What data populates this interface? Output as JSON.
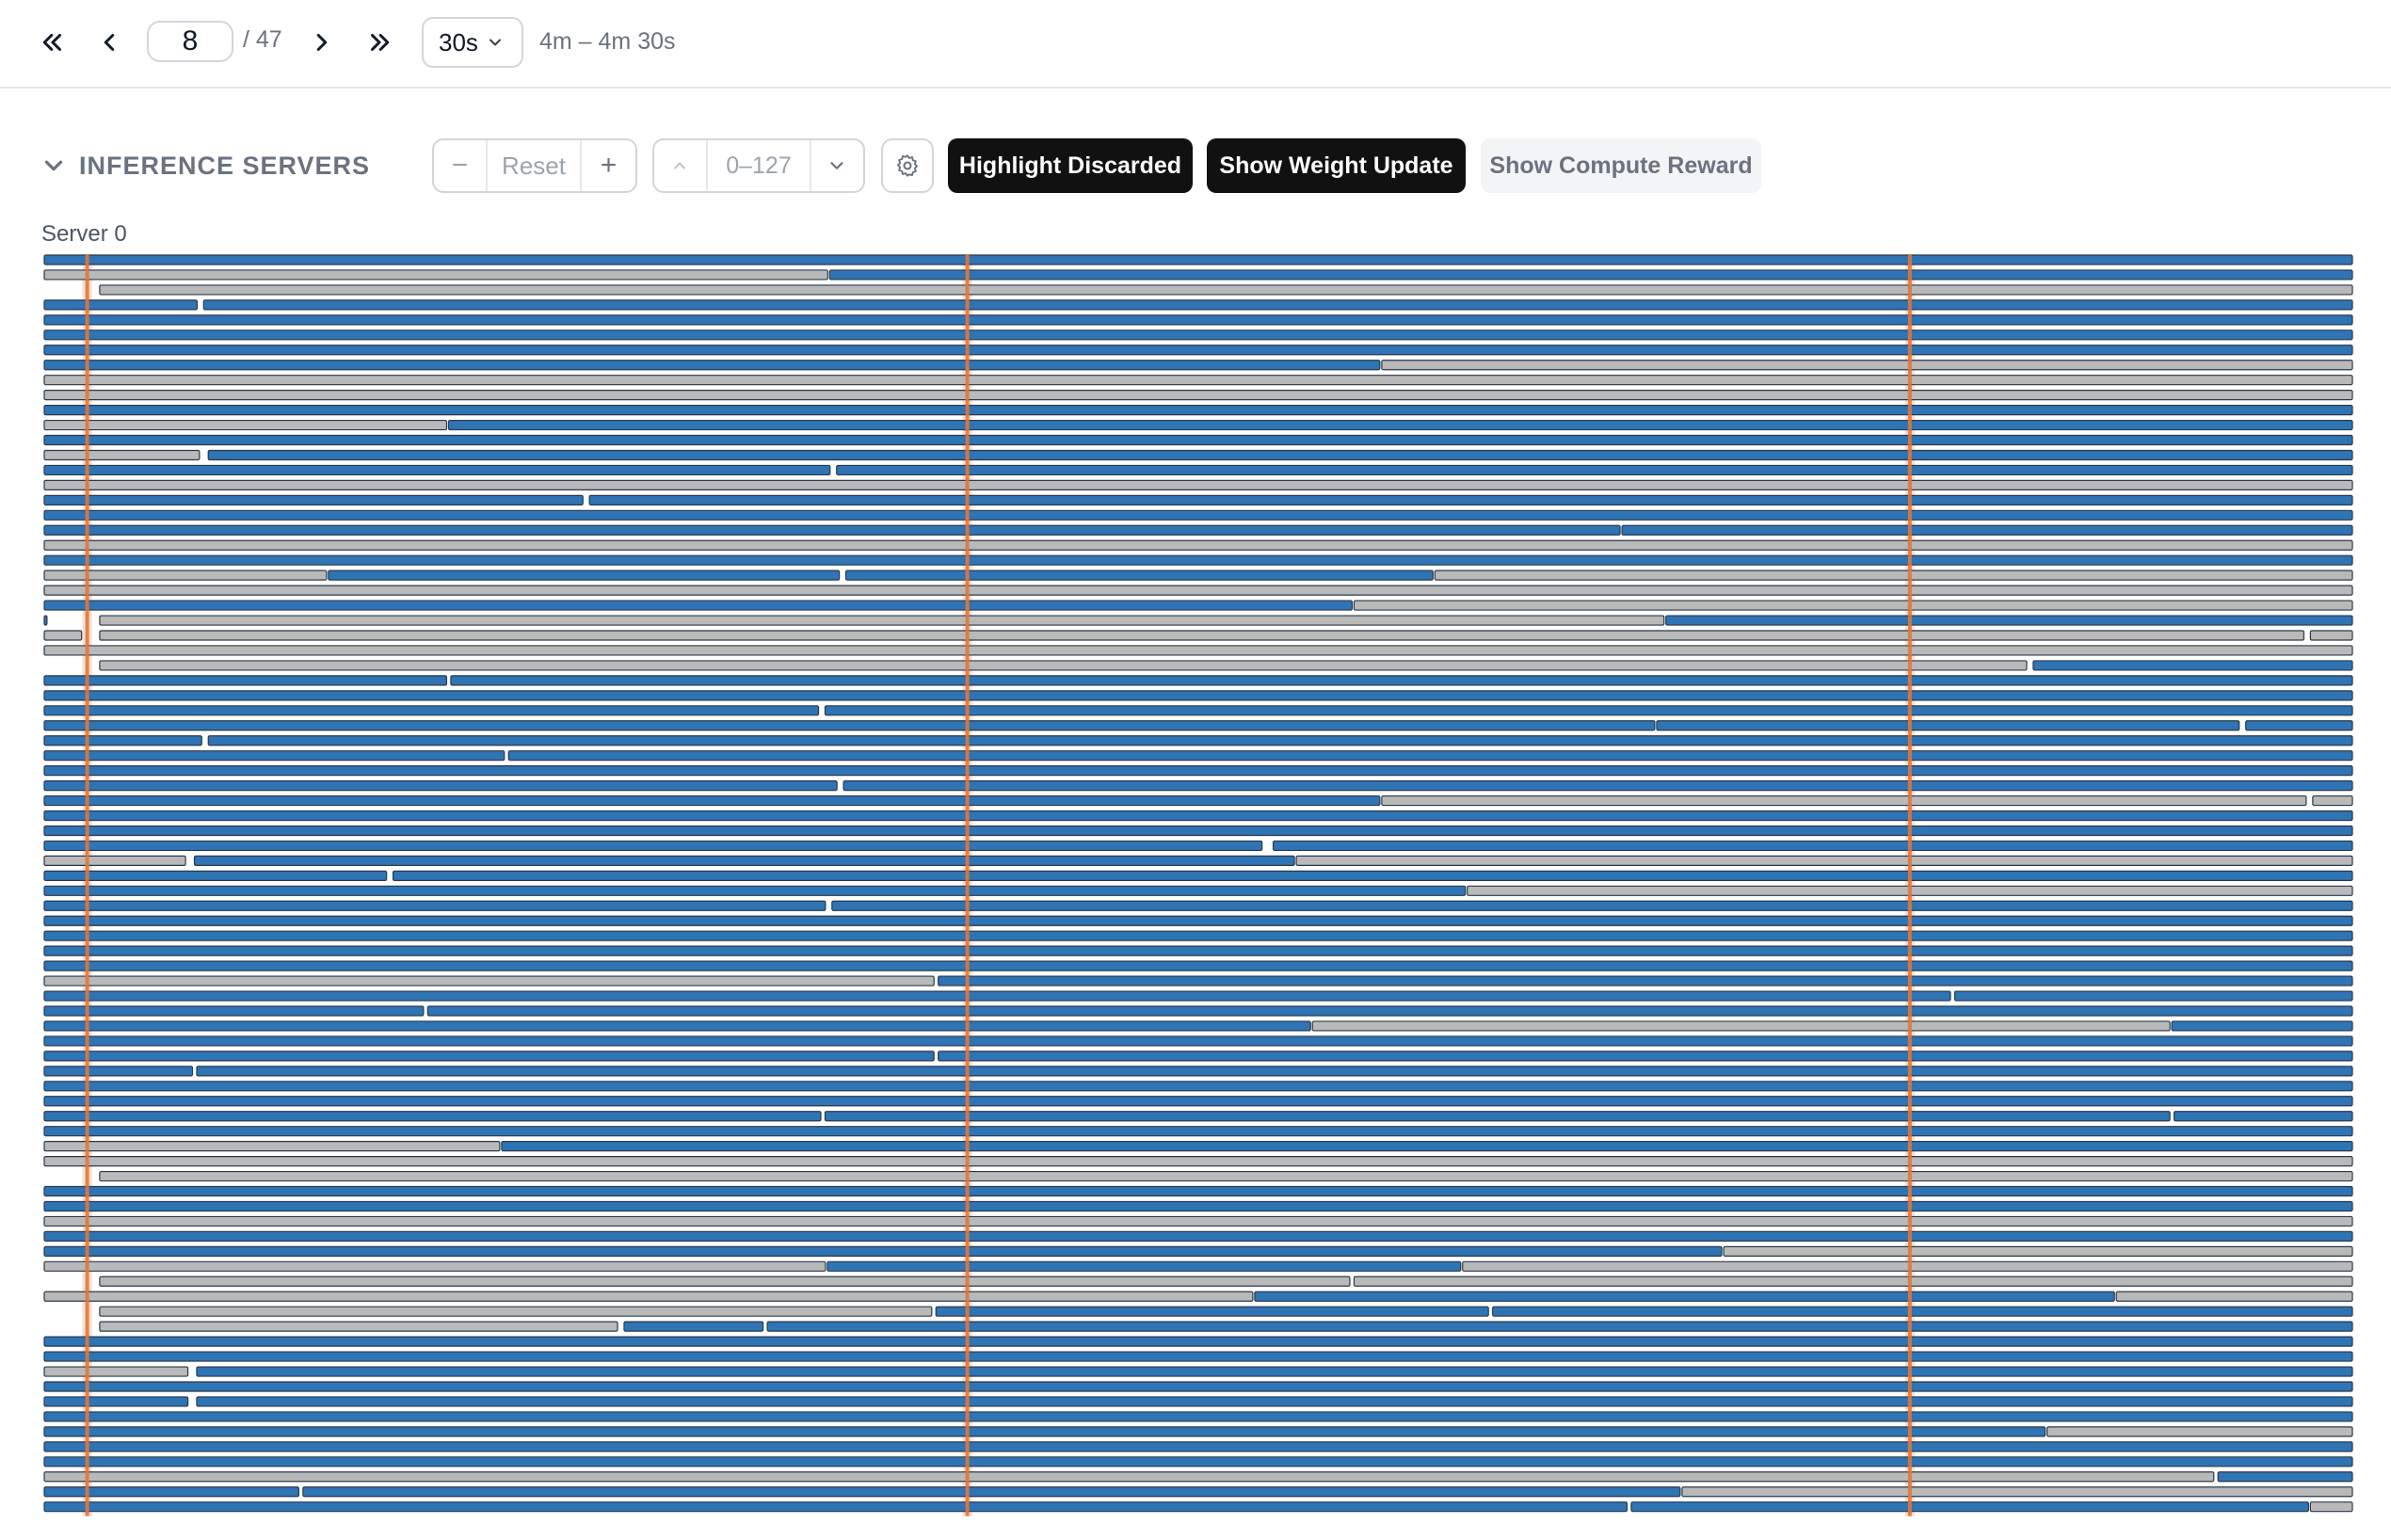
{
  "pagination": {
    "first_icon": "chevrons-left-icon",
    "prev_icon": "chevron-left-icon",
    "next_icon": "chevron-right-icon",
    "last_icon": "chevrons-right-icon",
    "current_page": "8",
    "total_pages": "/ 47"
  },
  "interval": {
    "selected": "30s"
  },
  "time_range": "4m – 4m 30s",
  "section": {
    "title": "INFERENCE SERVERS",
    "collapse_icon": "chevron-down-icon"
  },
  "zoom": {
    "minus_label": "−",
    "reset_label": "Reset",
    "plus_label": "+"
  },
  "range": {
    "up_icon": "chevron-up-icon",
    "label": "0–127",
    "down_icon": "chevron-down-icon"
  },
  "settings_icon": "gear-icon",
  "toggles": {
    "highlight_discarded": {
      "label": "Highlight Discarded",
      "active": true
    },
    "show_weight_update": {
      "label": "Show Weight Update",
      "active": true
    },
    "show_compute_reward": {
      "label": "Show Compute Reward",
      "active": false
    }
  },
  "server": {
    "label": "Server 0"
  },
  "colors": {
    "active_bar": "#2f74b5",
    "discarded_bar": "#b9b9b9",
    "bar_outline": "#2a3a4a",
    "weight_update": "#e0783a",
    "weight_update_band": "#f5ddd0"
  },
  "timeline": {
    "time_start": "4m",
    "time_end": "4m 30s",
    "weight_update_fractions": [
      0.019,
      0.4,
      0.808
    ],
    "rows": [
      [
        [
          "b",
          0,
          1
        ]
      ],
      [
        [
          "g",
          0,
          0.34
        ],
        [
          "b",
          0.34,
          1
        ]
      ],
      [
        [
          "g",
          0.024,
          1
        ]
      ],
      [
        [
          "b",
          0,
          0.067
        ],
        [
          "b",
          0.069,
          1
        ]
      ],
      [
        [
          "b",
          0,
          1
        ]
      ],
      [
        [
          "b",
          0,
          1
        ]
      ],
      [
        [
          "b",
          0,
          1
        ]
      ],
      [
        [
          "b",
          0,
          0.579
        ],
        [
          "g",
          0.579,
          1
        ]
      ],
      [
        [
          "g",
          0,
          1
        ]
      ],
      [
        [
          "g",
          0,
          1
        ]
      ],
      [
        [
          "b",
          0,
          1
        ]
      ],
      [
        [
          "g",
          0,
          0.175
        ],
        [
          "b",
          0.175,
          1
        ]
      ],
      [
        [
          "b",
          0,
          1
        ]
      ],
      [
        [
          "g",
          0,
          0.068
        ],
        [
          "b",
          0.071,
          1
        ]
      ],
      [
        [
          "b",
          0,
          0.341
        ],
        [
          "b",
          0.343,
          1
        ]
      ],
      [
        [
          "g",
          0,
          1
        ]
      ],
      [
        [
          "b",
          0,
          0.234
        ],
        [
          "b",
          0.236,
          1
        ]
      ],
      [
        [
          "b",
          0,
          1
        ]
      ],
      [
        [
          "b",
          0,
          0.683
        ],
        [
          "b",
          0.683,
          1
        ]
      ],
      [
        [
          "g",
          0,
          1
        ]
      ],
      [
        [
          "b",
          0,
          1
        ]
      ],
      [
        [
          "g",
          0,
          0.123
        ],
        [
          "b",
          0.123,
          0.345
        ],
        [
          "b",
          0.347,
          0.602
        ],
        [
          "g",
          0.602,
          1
        ]
      ],
      [
        [
          "g",
          0,
          1
        ]
      ],
      [
        [
          "b",
          0,
          0.567
        ],
        [
          "g",
          0.567,
          1
        ]
      ],
      [
        [
          "b",
          0,
          0.002
        ],
        [
          "g",
          0.024,
          0.702
        ],
        [
          "b",
          0.702,
          1
        ]
      ],
      [
        [
          "g",
          0,
          0.017
        ],
        [
          "g",
          0.024,
          0.979
        ],
        [
          "g",
          0.981,
          1
        ]
      ],
      [
        [
          "g",
          0,
          1
        ]
      ],
      [
        [
          "g",
          0.024,
          0.859
        ],
        [
          "b",
          0.861,
          1
        ]
      ],
      [
        [
          "b",
          0,
          0.175
        ],
        [
          "b",
          0.176,
          1
        ]
      ],
      [
        [
          "b",
          0,
          1
        ]
      ],
      [
        [
          "b",
          0,
          0.336
        ],
        [
          "b",
          0.338,
          1
        ]
      ],
      [
        [
          "b",
          0,
          0.698
        ],
        [
          "b",
          0.698,
          0.951
        ],
        [
          "b",
          0.953,
          1
        ]
      ],
      [
        [
          "b",
          0,
          0.069
        ],
        [
          "b",
          0.071,
          1
        ]
      ],
      [
        [
          "b",
          0,
          0.2
        ],
        [
          "b",
          0.201,
          1
        ]
      ],
      [
        [
          "b",
          0,
          1
        ]
      ],
      [
        [
          "b",
          0,
          0.344
        ],
        [
          "b",
          0.346,
          1
        ]
      ],
      [
        [
          "b",
          0,
          0.579
        ],
        [
          "g",
          0.579,
          0.98
        ],
        [
          "g",
          0.982,
          1
        ]
      ],
      [
        [
          "b",
          0,
          1
        ]
      ],
      [
        [
          "b",
          0,
          1
        ]
      ],
      [
        [
          "b",
          0,
          0.528
        ],
        [
          "b",
          0.532,
          1
        ]
      ],
      [
        [
          "g",
          0,
          0.062
        ],
        [
          "b",
          0.065,
          0.542
        ],
        [
          "g",
          0.542,
          1
        ]
      ],
      [
        [
          "b",
          0,
          0.149
        ],
        [
          "b",
          0.151,
          1
        ]
      ],
      [
        [
          "b",
          0,
          0.616
        ],
        [
          "g",
          0.616,
          1
        ]
      ],
      [
        [
          "b",
          0,
          0.339
        ],
        [
          "b",
          0.341,
          1
        ]
      ],
      [
        [
          "b",
          0,
          1
        ]
      ],
      [
        [
          "b",
          0,
          1
        ]
      ],
      [
        [
          "b",
          0,
          1
        ]
      ],
      [
        [
          "b",
          0,
          1
        ]
      ],
      [
        [
          "g",
          0,
          0.386
        ],
        [
          "b",
          0.387,
          1
        ]
      ],
      [
        [
          "b",
          0,
          0.826
        ],
        [
          "b",
          0.827,
          1
        ]
      ],
      [
        [
          "b",
          0,
          0.165
        ],
        [
          "b",
          0.166,
          1
        ]
      ],
      [
        [
          "b",
          0,
          0.549
        ],
        [
          "g",
          0.549,
          0.921
        ],
        [
          "b",
          0.921,
          1
        ]
      ],
      [
        [
          "b",
          0,
          1
        ]
      ],
      [
        [
          "b",
          0,
          0.386
        ],
        [
          "b",
          0.387,
          1
        ]
      ],
      [
        [
          "b",
          0,
          0.065
        ],
        [
          "b",
          0.066,
          1
        ]
      ],
      [
        [
          "b",
          0,
          1
        ]
      ],
      [
        [
          "b",
          0,
          1
        ]
      ],
      [
        [
          "b",
          0,
          0.337
        ],
        [
          "b",
          0.338,
          0.921
        ],
        [
          "b",
          0.922,
          1
        ]
      ],
      [
        [
          "b",
          0,
          1
        ]
      ],
      [
        [
          "g",
          0,
          0.198
        ],
        [
          "b",
          0.198,
          1
        ]
      ],
      [
        [
          "g",
          0,
          1
        ]
      ],
      [
        [
          "g",
          0.024,
          1
        ]
      ],
      [
        [
          "b",
          0,
          1
        ]
      ],
      [
        [
          "b",
          0,
          1
        ]
      ],
      [
        [
          "g",
          0,
          1
        ]
      ],
      [
        [
          "b",
          0,
          1
        ]
      ],
      [
        [
          "b",
          0,
          0.727
        ],
        [
          "g",
          0.727,
          1
        ]
      ],
      [
        [
          "g",
          0,
          0.339
        ],
        [
          "b",
          0.339,
          0.614
        ],
        [
          "g",
          0.614,
          1
        ]
      ],
      [
        [
          "g",
          0.024,
          0.566
        ],
        [
          "g",
          0.567,
          1
        ]
      ],
      [
        [
          "g",
          0,
          0.524
        ],
        [
          "b",
          0.524,
          0.897
        ],
        [
          "g",
          0.897,
          1
        ]
      ],
      [
        [
          "g",
          0.024,
          0.385
        ],
        [
          "b",
          0.386,
          0.626
        ],
        [
          "b",
          0.627,
          1
        ]
      ],
      [
        [
          "g",
          0.024,
          0.249
        ],
        [
          "b",
          0.251,
          0.312
        ],
        [
          "b",
          0.313,
          1
        ]
      ],
      [
        [
          "b",
          0,
          1
        ]
      ],
      [
        [
          "b",
          0,
          1
        ]
      ],
      [
        [
          "g",
          0,
          0.063
        ],
        [
          "b",
          0.066,
          1
        ]
      ],
      [
        [
          "b",
          0,
          1
        ]
      ],
      [
        [
          "b",
          0,
          0.063
        ],
        [
          "b",
          0.066,
          1
        ]
      ],
      [
        [
          "b",
          0,
          1
        ]
      ],
      [
        [
          "b",
          0,
          0.867
        ],
        [
          "g",
          0.867,
          1
        ]
      ],
      [
        [
          "b",
          0,
          1
        ]
      ],
      [
        [
          "b",
          0,
          1
        ]
      ],
      [
        [
          "g",
          0,
          0.94
        ],
        [
          "b",
          0.941,
          1
        ]
      ],
      [
        [
          "b",
          0,
          0.111
        ],
        [
          "b",
          0.112,
          0.709
        ],
        [
          "g",
          0.709,
          1
        ]
      ],
      [
        [
          "b",
          0,
          0.686
        ],
        [
          "b",
          0.687,
          0.981
        ],
        [
          "g",
          0.981,
          1
        ]
      ]
    ]
  }
}
